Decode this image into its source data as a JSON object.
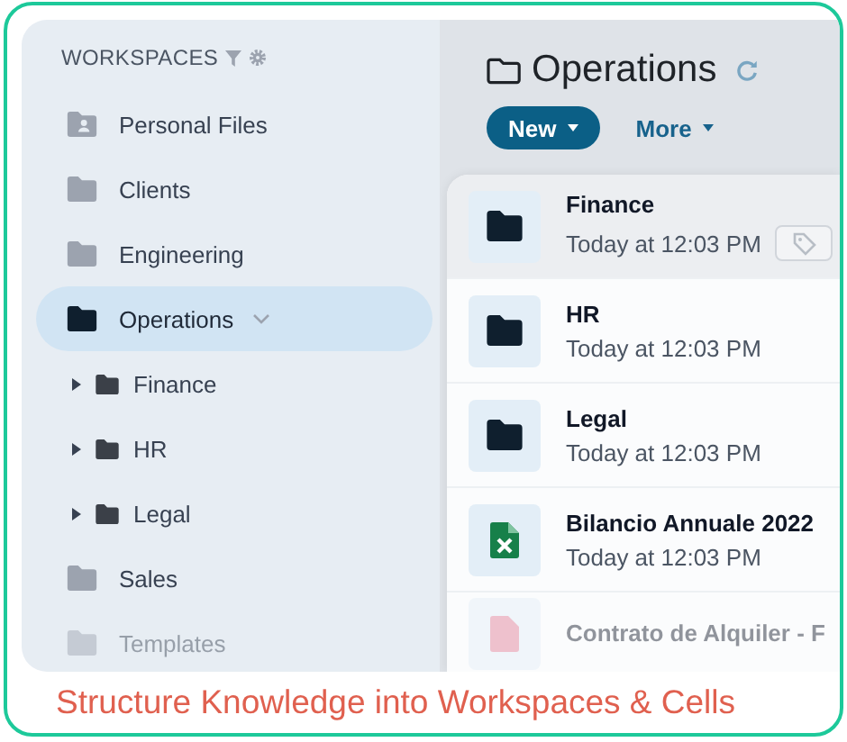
{
  "sidebar": {
    "header": "WORKSPACES",
    "items": [
      {
        "label": "Personal Files",
        "kind": "personal",
        "selected": false
      },
      {
        "label": "Clients",
        "kind": "folder",
        "selected": false
      },
      {
        "label": "Engineering",
        "kind": "folder",
        "selected": false
      },
      {
        "label": "Operations",
        "kind": "folder",
        "selected": true,
        "expanded": true,
        "children": [
          {
            "label": "Finance",
            "kind": "folder",
            "selected": false,
            "expanded": false
          },
          {
            "label": "HR",
            "kind": "folder",
            "selected": false,
            "expanded": false
          },
          {
            "label": "Legal",
            "kind": "folder",
            "selected": false,
            "expanded": false
          }
        ]
      },
      {
        "label": "Sales",
        "kind": "folder",
        "selected": false
      },
      {
        "label": "Templates",
        "kind": "folder",
        "selected": false
      }
    ]
  },
  "main": {
    "title": "Operations",
    "buttons": [
      {
        "label": "New",
        "kind": "primary"
      },
      {
        "label": "More",
        "kind": "link"
      }
    ],
    "items": [
      {
        "name": "Finance",
        "date": "Today at 12:03 PM",
        "kind": "folder",
        "selected": true
      },
      {
        "name": "HR",
        "date": "Today at 12:03 PM",
        "kind": "folder",
        "selected": false
      },
      {
        "name": "Legal",
        "date": "Today at 12:03 PM",
        "kind": "folder",
        "selected": false
      },
      {
        "name": "Bilancio Annuale 2022",
        "date": "Today at 12:03 PM",
        "kind": "spreadsheet",
        "selected": false
      },
      {
        "name": "Contrato de Alquiler - F",
        "kind": "pdf",
        "selected": false
      }
    ]
  },
  "caption": "Structure Knowledge into Workspaces & Cells"
}
